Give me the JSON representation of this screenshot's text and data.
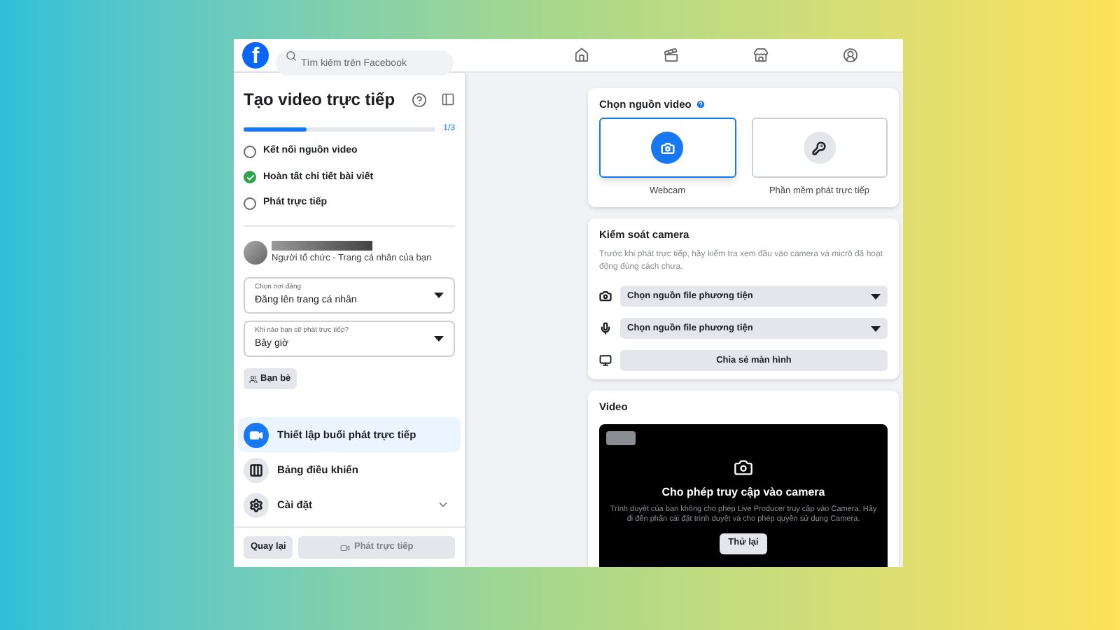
{
  "header": {
    "logo": "f",
    "search": {
      "placeholder": "Tìm kiếm trên Facebook"
    }
  },
  "sidebar": {
    "title": "Tạo video trực tiếp",
    "progress": {
      "level": 0.33,
      "reading": "1/3"
    },
    "steps": [
      {
        "label": "Kết nối nguồn video",
        "checked": false
      },
      {
        "label": "Hoàn tất chi tiết bài viết",
        "checked": true
      },
      {
        "label": "Phát trực tiếp",
        "checked": false
      }
    ],
    "organizer": "Người tổ chức - Trang cá nhân của bạn",
    "selects": [
      {
        "label": "Chọn nơi đăng",
        "value": "Đăng lên trang cá nhân"
      },
      {
        "label": "Khi nào bạn sẽ phát trực tiếp?",
        "value": "Bây giờ"
      }
    ],
    "audience": "Bạn bè",
    "menu": [
      {
        "label": "Thiết lập buổi phát trực tiếp",
        "kind": "camera",
        "selected": true
      },
      {
        "label": "Bảng điều khiển",
        "kind": "dashboard",
        "selected": false
      },
      {
        "label": "Cài đặt",
        "kind": "settings",
        "selected": false
      }
    ],
    "buttons": [
      {
        "label": "Quay lại",
        "disabled": false
      },
      {
        "label": "Phát trực tiếp",
        "disabled": true
      }
    ]
  },
  "video_source": {
    "title": "Chọn nguồn video",
    "options": [
      {
        "label": "Webcam",
        "kind": "webcam",
        "selected": true
      },
      {
        "label": "Phần mềm phát trực tiếp",
        "kind": "software",
        "selected": false
      }
    ]
  },
  "camera_control": {
    "title": "Kiểm soát camera",
    "description": "Trước khi phát trực tiếp, hãy kiểm tra xem đầu vào camera và micrô đã hoạt động đúng cách chưa.",
    "controls": [
      {
        "kind": "camera",
        "value": "Chọn nguồn file phương tiện"
      },
      {
        "kind": "mic",
        "value": "Chọn nguồn file phương tiện"
      },
      {
        "kind": "screen",
        "value": "Chia sẻ màn hình"
      }
    ]
  },
  "video": {
    "title": "Video",
    "heading": "Cho phép truy cập vào camera",
    "message": "Trình duyệt của bạn không cho phép Live Producer truy cập vào Camera. Hãy đi đến phần cài đặt trình duyệt và cho phép quyền sử dụng Camera.",
    "button": "Thử lại"
  }
}
